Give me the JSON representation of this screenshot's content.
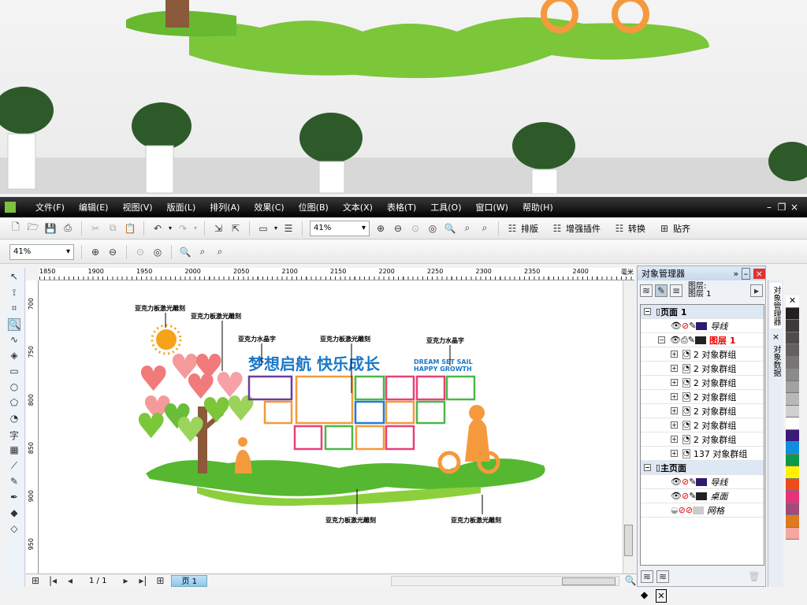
{
  "menu": [
    "文件(F)",
    "编辑(E)",
    "视图(V)",
    "版面(L)",
    "排列(A)",
    "效果(C)",
    "位图(B)",
    "文本(X)",
    "表格(T)",
    "工具(O)",
    "窗口(W)",
    "帮助(H)"
  ],
  "toolbar": {
    "zoom": "41%",
    "plugins": [
      "排版",
      "增强插件",
      "转换",
      "贴齐"
    ]
  },
  "toolbar2": {
    "zoom": "41%"
  },
  "ruler": {
    "h": [
      "1850",
      "1900",
      "1950",
      "2000",
      "2050",
      "2100",
      "2150",
      "2200",
      "2250",
      "2300",
      "2350",
      "2400"
    ],
    "unit": "毫米",
    "v": [
      "700",
      "750",
      "800",
      "850",
      "900",
      "950"
    ]
  },
  "artwork": {
    "title_cn": "梦想启航  快乐成长",
    "title_en1": "DREAM SET SAIL",
    "title_en2": "HAPPY GROWTH",
    "labels": [
      "亚克力板激光雕刻",
      "亚克力板激光雕刻",
      "亚克力水晶字",
      "亚克力板激光雕刻",
      "亚克力水晶字",
      "亚克力板激光雕刻",
      "亚克力板激光雕刻"
    ],
    "frame_colors": [
      "#6a3d9a",
      "#f39a3c",
      "#4cb848",
      "#e8417a",
      "#e8417a",
      "#4cb848",
      "#f39a3c",
      "#1f7fd4",
      "#f39a3c",
      "#4cb848",
      "#e8417a",
      "#4cb848",
      "#f39a3c",
      "#e8417a"
    ],
    "accent": "#1a78c8"
  },
  "status": {
    "page_count": "1 / 1",
    "page_tab": "页 1"
  },
  "docker": {
    "title": "对象管理器",
    "layer_label1": "图层:",
    "layer_label2": "图层 1",
    "page1": "页面 1",
    "guides": "导线",
    "layer1": "图层 1",
    "groups": [
      "2 对象群组",
      "2 对象群组",
      "2 对象群组",
      "2 对象群组",
      "2 对象群组",
      "2 对象群组",
      "2 对象群组",
      "137 对象群组"
    ],
    "master": "主页面",
    "master_layers": [
      "导线",
      "桌面",
      "网格"
    ]
  },
  "sidetabs": [
    "对象管理器",
    "对象数据"
  ],
  "palette": [
    "#ffffff",
    "#231f20",
    "#3c3a3a",
    "#4d4b4b",
    "#626060",
    "#777575",
    "#8c8a8a",
    "#a3a1a1",
    "#b9b8b8",
    "#d1d0d0",
    "#ffffff",
    "#3a1a7a",
    "#0f8ee0",
    "#0a9a4a",
    "#fff200",
    "#ef4a1b",
    "#e8317a",
    "#a24a7a",
    "#e07a20",
    "#f6a6a0"
  ]
}
